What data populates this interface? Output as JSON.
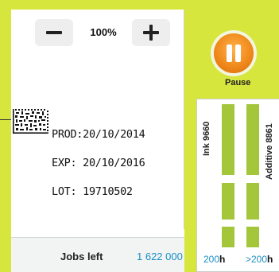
{
  "zoom": {
    "value": "100%"
  },
  "label": {
    "lines": [
      "PROD:20/10/2014",
      "EXP: 20/10/2016",
      "LOT: 19710502"
    ]
  },
  "jobs": {
    "label": "Jobs left",
    "value": "1 622 000"
  },
  "pause": {
    "label": "Pause"
  },
  "consumables": [
    {
      "name": "Ink 9660",
      "time_value": "200",
      "time_unit": "h"
    },
    {
      "name": "Additive 8861",
      "time_value": ">200",
      "time_unit": "h"
    }
  ],
  "colors": {
    "frame": "#d7e63c",
    "level": "#a4c63a",
    "accent": "#1a8fc4",
    "pause": "#f08a1c"
  },
  "icons": {
    "zoom_out": "minus-icon",
    "zoom_in": "plus-icon",
    "pause": "pause-icon"
  }
}
